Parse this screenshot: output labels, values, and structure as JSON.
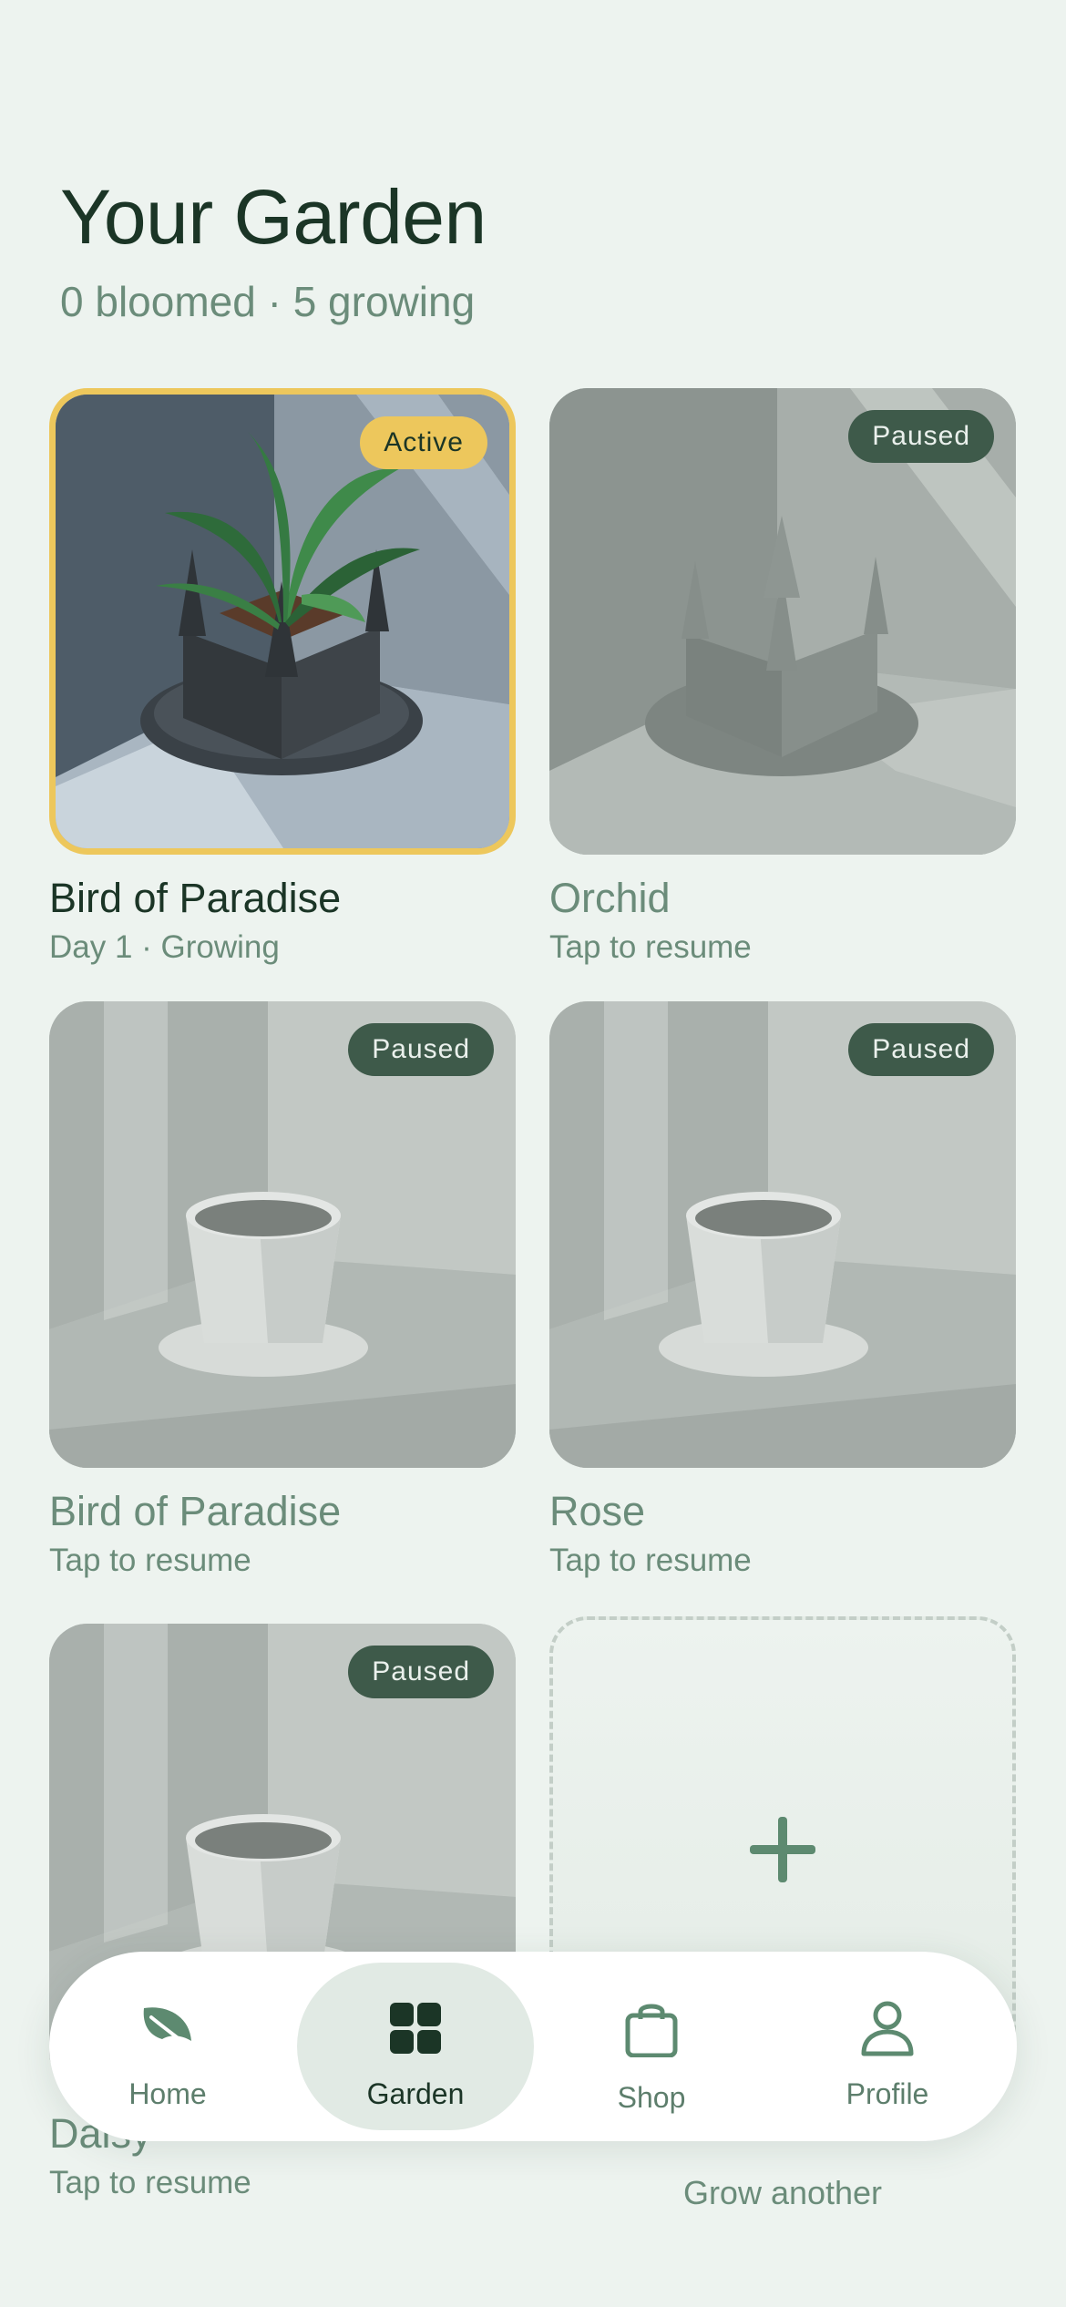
{
  "header": {
    "title": "Your Garden",
    "summary": "0 bloomed · 5 growing"
  },
  "plants": [
    {
      "name": "Bird of Paradise",
      "status": "Day 1 · Growing",
      "badge": "Active"
    },
    {
      "name": "Orchid",
      "status": "Tap to resume",
      "badge": "Paused"
    },
    {
      "name": "Bird of Paradise",
      "status": "Tap to resume",
      "badge": "Paused"
    },
    {
      "name": "Rose",
      "status": "Tap to resume",
      "badge": "Paused"
    },
    {
      "name": "Daisy",
      "status": "Tap to resume",
      "badge": "Paused"
    }
  ],
  "add_card": {
    "label": "Grow another",
    "icon": "plus-icon"
  },
  "nav": {
    "items": [
      {
        "label": "Home",
        "icon": "leaf-icon"
      },
      {
        "label": "Garden",
        "icon": "grid-icon",
        "selected": true
      },
      {
        "label": "Shop",
        "icon": "bag-icon"
      },
      {
        "label": "Profile",
        "icon": "person-icon"
      }
    ]
  },
  "colors": {
    "background": "#EDF3EF",
    "accent_active": "#EDC75C",
    "badge_paused": "#3E5A4A",
    "primary_text": "#1B3526",
    "muted_text": "#6B8C7A"
  }
}
